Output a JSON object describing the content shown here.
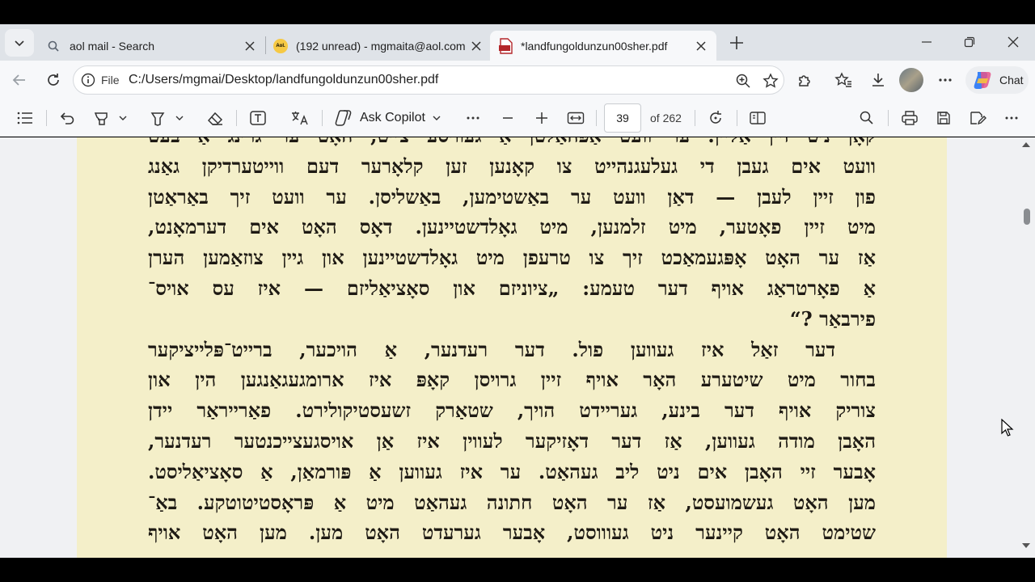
{
  "tabs": [
    {
      "label": "aol mail - Search",
      "icon": "search-icon"
    },
    {
      "label": "(192 unread) - mgmaita@aol.com",
      "icon": "aol-logo-icon"
    },
    {
      "label": "*landfungoldunzun00sher.pdf",
      "icon": "pdf-file-icon",
      "active": true
    }
  ],
  "address": {
    "scheme_label": "File",
    "url": "C:/Users/mgmai/Desktop/landfungoldunzun00sher.pdf"
  },
  "chat": {
    "label": "Chat"
  },
  "pdf_toolbar": {
    "ask_copilot": "Ask Copilot",
    "page_number": "39",
    "page_total": "of 262"
  },
  "page_lines": [
    "קאָן ניט זיין אַליין. ער וועט אַפּהאַלטן אַ געוויסע צייט, האָט ער גרינג אַ בעט",
    "וועט אים געבן די געלעגנהייט צו קאָנען זען קלאָרער דעם ווייטערדיקן גאַנג",
    "פון זיין לעבן — דאַן וועט ער באַשטימען, באַשליסן. ער וועט זיך באַראַטן",
    "מיט זיין פאָטער, מיט זלמנען, מיט גאָלדשטיינען. דאָס האָט אים דערמאָנט,",
    "אַז ער האָט אָפּגעמאַכט זיך צו טרעפן מיט גאָלדשטיינען און גיין צוזאַמען הערן",
    "אַ פאָרטראַג אויף דער טעמע: „ציוניזם און סאָציאַליזם — איז עס אויס־",
    "פירבאַר ?“",
    "דער זאַל איז געווען פול. דער רעדנער, אַ הויכער, ברייט־פּלייציקער",
    "בחור מיט שיטערע האָר אויף זיין גרויסן קאָפּ איז ארומגעגאַנגען הין און",
    "צוריק אויף דער בינע, געריידט הויך, שטאַרק זשעסטיקולירט. פאַרייראַר יידן",
    "האָבן מודה געווען, אַז דער דאָזיקער לעווין איז אַן אויסגעצייכנטער רעדנער,",
    "אָבער זיי האָבן אים ניט ליב געהאַט. ער איז געווען אַ פּורמאַן, אַ סאָציאַליסט.",
    "מען האָט געשמועסט, אַז ער האָט חתונה געהאַט מיט אַ פּראָסטיטוטקע. באַ־",
    "שטימט האָט קיינער ניט געוווסט, אָבער גערעדט האָט מען. מען האָט אויף"
  ]
}
